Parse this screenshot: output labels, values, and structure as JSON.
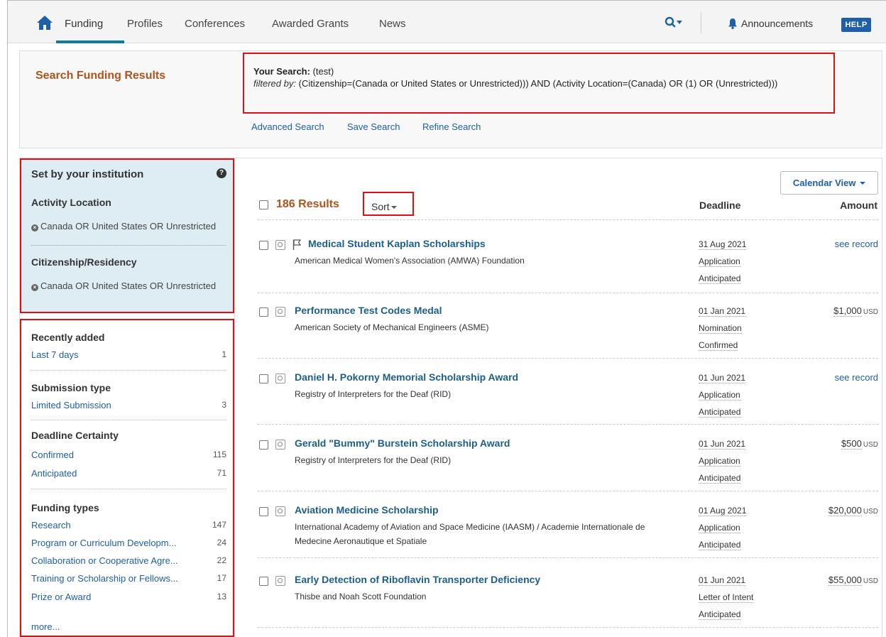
{
  "nav": {
    "items": [
      "Funding",
      "Profiles",
      "Conferences",
      "Awarded Grants",
      "News"
    ],
    "announcements": "Announcements",
    "help": "HELP"
  },
  "header": {
    "title": "Search Funding Results",
    "search_label": "Your Search:",
    "search_value": "(test)",
    "filtered_label": "filtered by:",
    "filtered_value": "(Citizenship=(Canada or United States or Unrestricted))) AND (Activity Location=(Canada) OR (1) OR (Unrestricted)))",
    "links": [
      "Advanced Search",
      "Save Search",
      "Refine Search"
    ]
  },
  "institution": {
    "title": "Set by your institution",
    "activity_title": "Activity Location",
    "activity_value": "Canada OR United States OR Unrestricted",
    "citizenship_title": "Citizenship/Residency",
    "citizenship_value": "Canada OR United States OR Unrestricted"
  },
  "facets": {
    "recently_added": {
      "title": "Recently added",
      "items": [
        {
          "label": "Last 7 days",
          "count": "1"
        }
      ]
    },
    "submission_type": {
      "title": "Submission type",
      "items": [
        {
          "label": "Limited Submission",
          "count": "3"
        }
      ]
    },
    "deadline_certainty": {
      "title": "Deadline Certainty",
      "items": [
        {
          "label": "Confirmed",
          "count": "115"
        },
        {
          "label": "Anticipated",
          "count": "71"
        }
      ]
    },
    "funding_types": {
      "title": "Funding types",
      "items": [
        {
          "label": "Research",
          "count": "147"
        },
        {
          "label": "Program or Curriculum Developm...",
          "count": "24"
        },
        {
          "label": "Collaboration or Cooperative Agre...",
          "count": "22"
        },
        {
          "label": "Training or Scholarship or Fellows...",
          "count": "17"
        },
        {
          "label": "Prize or Award",
          "count": "13"
        }
      ]
    },
    "more": "more..."
  },
  "results": {
    "calendar_view": "Calendar View",
    "count_label": "186 Results",
    "sort_label": "Sort",
    "deadline_header": "Deadline",
    "amount_header": "Amount",
    "rows": [
      {
        "title": "Medical Student Kaplan Scholarships",
        "org": "American Medical Women's Association (AMWA) Foundation",
        "deadline": "31 Aug 2021",
        "type": "Application",
        "status": "Anticipated",
        "amount": "see record",
        "currency": ""
      },
      {
        "title": "Performance Test Codes Medal",
        "org": "American Society of Mechanical Engineers (ASME)",
        "deadline": "01 Jan 2021",
        "type": "Nomination",
        "status": "Confirmed",
        "amount": "$1,000",
        "currency": "USD"
      },
      {
        "title": "Daniel H. Pokorny Memorial Scholarship Award",
        "org": "Registry of Interpreters for the Deaf (RID)",
        "deadline": "01 Jun 2021",
        "type": "Application",
        "status": "Anticipated",
        "amount": "see record",
        "currency": ""
      },
      {
        "title": "Gerald \"Bummy\" Burstein Scholarship Award",
        "org": "Registry of Interpreters for the Deaf (RID)",
        "deadline": "01 Jun 2021",
        "type": "Application",
        "status": "Anticipated",
        "amount": "$500",
        "currency": "USD"
      },
      {
        "title": "Aviation Medicine Scholarship",
        "org": "International Academy of Aviation and Space Medicine (IAASM) / Academie Internationale de Medecine Aeronautique et Spatiale",
        "deadline": "01 Aug 2021",
        "type": "Application",
        "status": "Anticipated",
        "amount": "$20,000",
        "currency": "USD"
      },
      {
        "title": "Early Detection of Riboflavin Transporter Deficiency",
        "org": "Thisbe and Noah Scott Foundation",
        "deadline": "01 Jun 2021",
        "type": "Letter of Intent",
        "status": "Anticipated",
        "amount": "$55,000",
        "currency": "USD"
      }
    ]
  },
  "colors": {
    "accent_blue": "#1f5fa8",
    "title_orange": "#b0541c",
    "highlight_red": "#e01010",
    "institution_bg": "#deedf3"
  }
}
